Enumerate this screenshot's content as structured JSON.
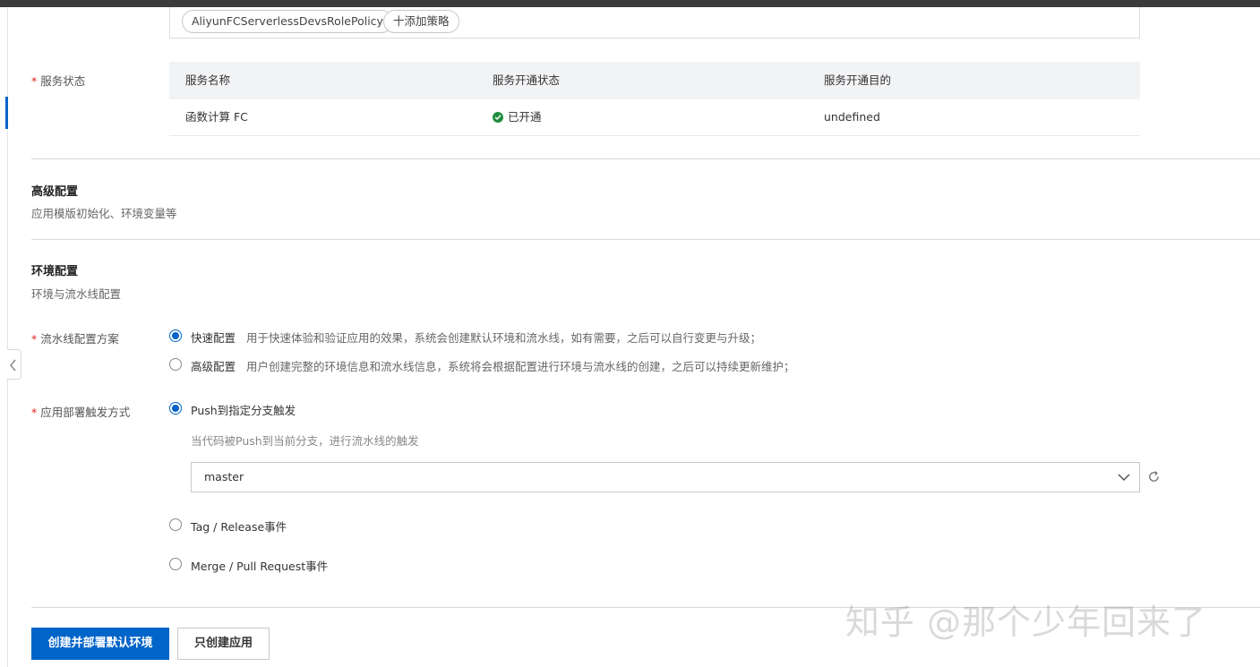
{
  "policies": {
    "tag": "AliyunFCServerlessDevsRolePolicy",
    "add_label": "十添加策略"
  },
  "service_status": {
    "label": "服务状态",
    "headers": [
      "服务名称",
      "服务开通状态",
      "服务开通目的"
    ],
    "row": {
      "name": "函数计算 FC",
      "status": "已开通",
      "purpose": "undefined"
    }
  },
  "advanced": {
    "title": "高级配置",
    "desc": "应用模版初始化、环境变量等"
  },
  "environment": {
    "title": "环境配置",
    "desc": "环境与流水线配置"
  },
  "pipeline": {
    "label": "流水线配置方案",
    "options": [
      {
        "label": "快速配置",
        "desc": "用于快速体验和验证应用的效果，系统会创建默认环境和流水线，如有需要，之后可以自行变更与升级；",
        "selected": true
      },
      {
        "label": "高级配置",
        "desc": "用户创建完整的环境信息和流水线信息，系统将会根据配置进行环境与流水线的创建，之后可以持续更新维护；",
        "selected": false
      }
    ]
  },
  "trigger": {
    "label": "应用部署触发方式",
    "push_label": "Push到指定分支触发",
    "push_hint": "当代码被Push到当前分支，进行流水线的触发",
    "branch": "master",
    "tag_label": "Tag / Release事件",
    "merge_label": "Merge / Pull Request事件",
    "selected": "push"
  },
  "buttons": {
    "primary": "创建并部署默认环境",
    "secondary": "只创建应用"
  },
  "watermark": "知乎 @那个少年回来了",
  "colors": {
    "accent": "#0064c8",
    "success": "#1e8e3e",
    "required": "#e2231a"
  }
}
